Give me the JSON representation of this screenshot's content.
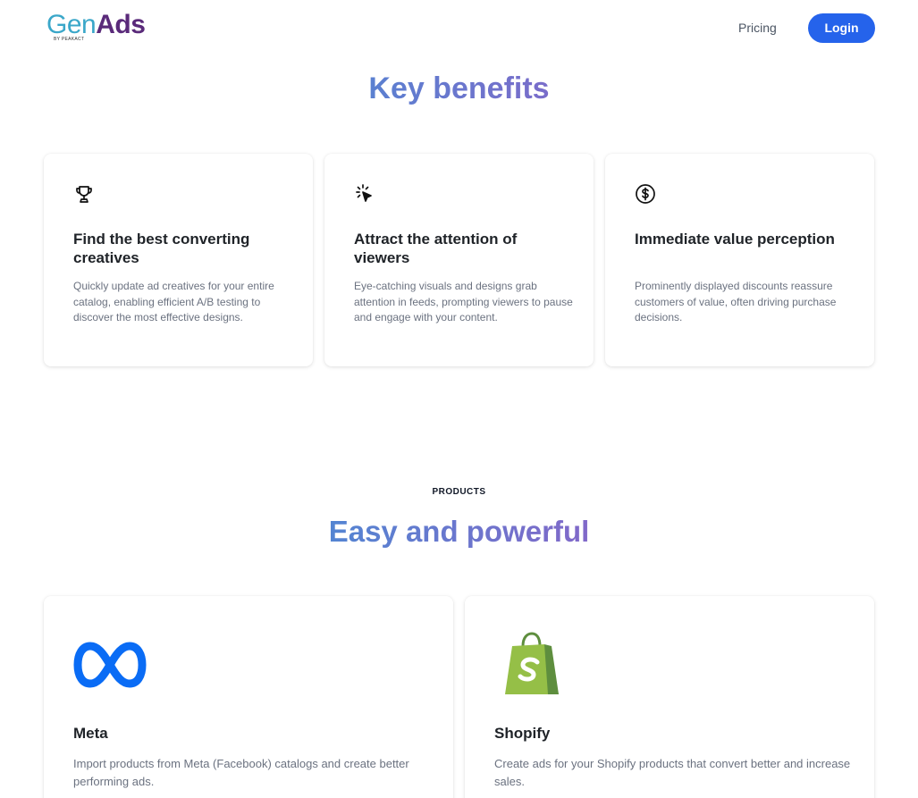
{
  "header": {
    "logo": {
      "part1": "Gen",
      "part2": "Ads",
      "byline": "BY PEAKACT"
    },
    "nav": {
      "pricing": "Pricing",
      "login": "Login"
    }
  },
  "benefits": {
    "title": "Key benefits",
    "items": [
      {
        "icon": "trophy-icon",
        "title": "Find the best converting creatives",
        "description": "Quickly update ad creatives for your entire catalog, enabling efficient A/B testing to discover the most effective designs."
      },
      {
        "icon": "cursor-click-icon",
        "title": "Attract the attention of viewers",
        "description": "Eye-catching visuals and designs grab attention in feeds, prompting viewers to pause and engage with your content."
      },
      {
        "icon": "dollar-circle-icon",
        "title": "Immediate value perception",
        "description": "Prominently displayed discounts reassure customers of value, often driving purchase decisions."
      }
    ]
  },
  "products": {
    "eyebrow": "PRODUCTS",
    "title": "Easy and powerful",
    "items": [
      {
        "icon": "meta-logo",
        "title": "Meta",
        "description": "Import products from Meta (Facebook) catalogs and create better performing ads."
      },
      {
        "icon": "shopify-logo",
        "title": "Shopify",
        "description": "Create ads for your Shopify products that convert better and increase sales."
      }
    ]
  },
  "colors": {
    "accent": "#2563eb",
    "gradient_start": "#4a8ad4",
    "gradient_end": "#8a63c7",
    "meta_blue": "#0a6cf5",
    "shopify_green": "#95bf47"
  }
}
